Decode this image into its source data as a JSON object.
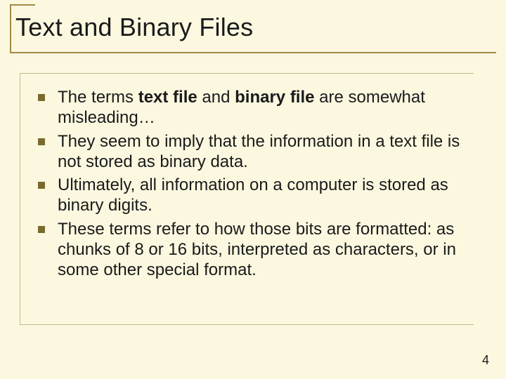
{
  "title": "Text and Binary Files",
  "bullets": [
    {
      "pre": "The terms ",
      "bold1": "text file",
      "mid": " and ",
      "bold2": "binary file",
      "post": " are somewhat misleading…"
    },
    {
      "text": "They seem to imply that the information in a text file is not stored as binary data."
    },
    {
      "text": "Ultimately, all information on a computer is stored as binary digits."
    },
    {
      "text": "These terms refer to how those bits are formatted: as chunks of 8 or 16 bits, interpreted as characters, or in some other special format."
    }
  ],
  "page_number": "4"
}
